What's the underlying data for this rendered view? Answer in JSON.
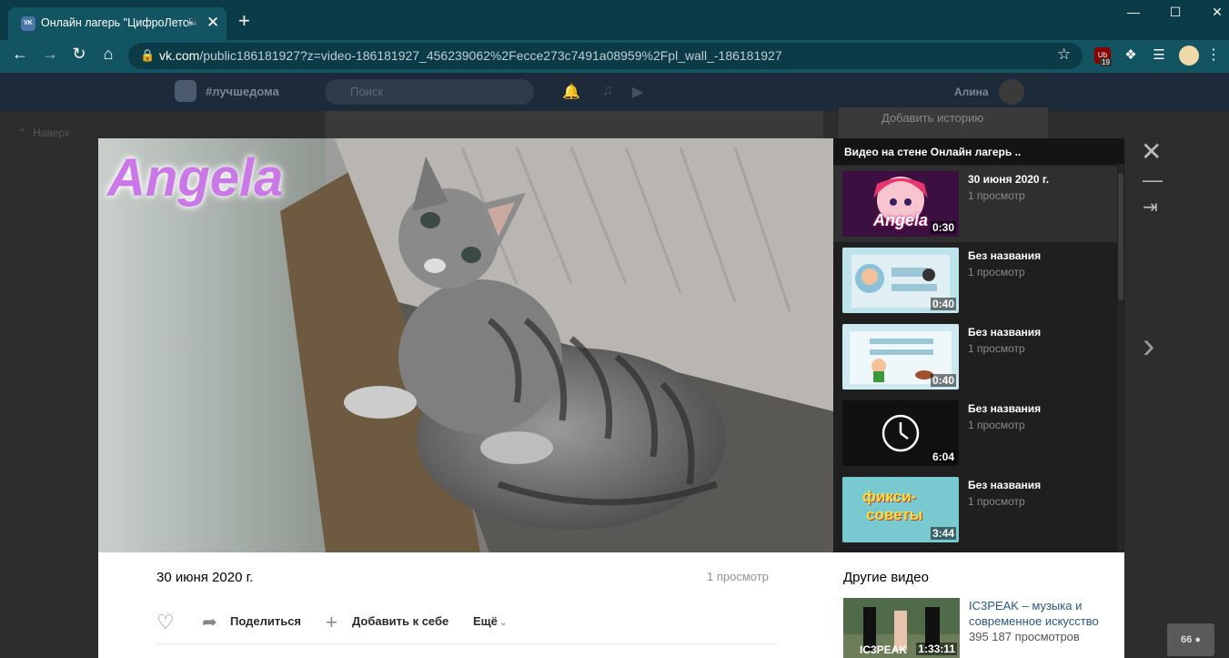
{
  "browser": {
    "tab_title": "Онлайн лагерь \"ЦифроЛето\"",
    "favicon_text": "VK",
    "url_host": "vk.com",
    "url_path": "/public186181927?z=video-186181927_456239062%2Fecce273c7491a08959%2Fpl_wall_-186181927",
    "ublock_badge": "19",
    "ublock_text": "Ub"
  },
  "vk": {
    "tag": "#лучшедома",
    "search_placeholder": "Поиск",
    "user": "Алина",
    "back": "Наверх",
    "story": "Добавить историю"
  },
  "playlist": {
    "heading": "Видео на стене Онлайн лагерь ..",
    "items": [
      {
        "title": "30 июня 2020 г.",
        "views": "1 просмотр",
        "duration": "0:30"
      },
      {
        "title": "Без названия",
        "views": "1 просмотр",
        "duration": "0:40"
      },
      {
        "title": "Без названия",
        "views": "1 просмотр",
        "duration": "0:40"
      },
      {
        "title": "Без названия",
        "views": "1 просмотр",
        "duration": "6:04"
      },
      {
        "title": "Без названия",
        "views": "1 просмотр",
        "duration": "3:44"
      }
    ]
  },
  "video": {
    "overlay_text": "Angela",
    "date": "30 июня 2020 г.",
    "views": "1 просмотр",
    "share": "Поделиться",
    "add": "Добавить к себе",
    "more": "Ещё"
  },
  "thumb_texts": {
    "t0": "Angela",
    "t4a": "фикси-",
    "t4b": "советы",
    "other": "IC3PEAK"
  },
  "other_videos": {
    "heading": "Другие видео",
    "title": "IC3PEAK – музыка и современное искусство",
    "views": "395 187 просмотров",
    "duration": "1:33:11"
  },
  "online_count": "66"
}
